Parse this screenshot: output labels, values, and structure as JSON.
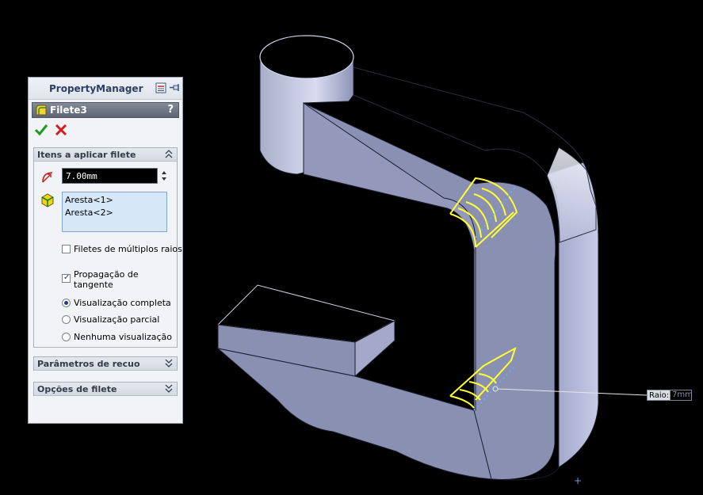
{
  "property_manager": {
    "title": "PropertyManager",
    "feature_name": "Filete3",
    "help": "?",
    "groups": {
      "items": {
        "title": "Itens a aplicar filete",
        "radius_value": "7.00mm",
        "edges": [
          "Aresta<1>",
          "Aresta<2>"
        ],
        "multi_radius_label": "Filetes de múltiplos raios",
        "tangent_label_1": "Propagação de",
        "tangent_label_2": "tangente",
        "full_preview_label": "Visualização completa",
        "partial_preview_label": "Visualização parcial",
        "no_preview_label": "Nenhuma visualização"
      },
      "setback": {
        "title": "Parâmetros de recuo"
      },
      "options": {
        "title": "Opções de filete"
      }
    },
    "state": {
      "multi_radius": false,
      "tangent_propagation": true,
      "preview": "Visualização completa"
    }
  },
  "viewport": {
    "callout_label": "Raio:",
    "callout_value": "7mm"
  },
  "colors": {
    "background": "#000000",
    "part_face": "#8a90b2",
    "part_light": "#c9cde8",
    "highlight": "#ffff33"
  }
}
